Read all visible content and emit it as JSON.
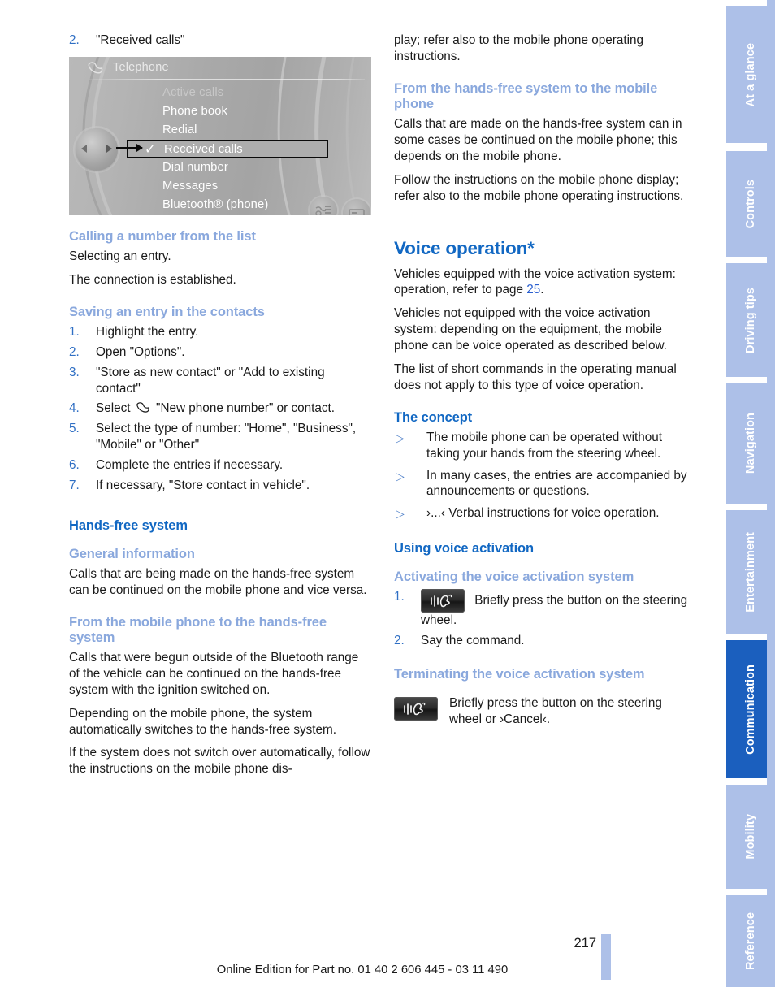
{
  "document": {
    "page_number": "217",
    "footer_text": "Online Edition for Part no. 01 40 2 606 445 - 03 11 490"
  },
  "sidebar": {
    "tabs": [
      {
        "label": "At a glance",
        "active": false
      },
      {
        "label": "Controls",
        "active": false
      },
      {
        "label": "Driving tips",
        "active": false
      },
      {
        "label": "Navigation",
        "active": false
      },
      {
        "label": "Entertainment",
        "active": false
      },
      {
        "label": "Communication",
        "active": true
      },
      {
        "label": "Mobility",
        "active": false
      },
      {
        "label": "Reference",
        "active": false
      }
    ]
  },
  "left_column": {
    "step_intro": {
      "num": "2.",
      "text": "\"Received calls\""
    },
    "idrive": {
      "title": "Telephone",
      "menu_items": [
        {
          "label": "Active calls",
          "dim": true,
          "selected": false
        },
        {
          "label": "Phone book",
          "dim": false,
          "selected": false
        },
        {
          "label": "Redial",
          "dim": false,
          "selected": false
        },
        {
          "label": "Received calls",
          "dim": false,
          "selected": true
        },
        {
          "label": "Dial number",
          "dim": false,
          "selected": false
        },
        {
          "label": "Messages",
          "dim": false,
          "selected": false
        },
        {
          "label": "Bluetooth® (phone)",
          "dim": false,
          "selected": false
        }
      ],
      "checkmark": "✓"
    },
    "calling_heading": "Calling a number from the list",
    "calling_p1": "Selecting an entry.",
    "calling_p2": "The connection is established.",
    "saving_heading": "Saving an entry in the contacts",
    "saving_steps": [
      {
        "num": "1.",
        "text": "Highlight the entry."
      },
      {
        "num": "2.",
        "text": "Open \"Options\"."
      },
      {
        "num": "3.",
        "text": "\"Store as new contact\" or \"Add to existing contact\""
      },
      {
        "num": "4.",
        "text_before": "Select",
        "icon": "phone-handset-icon",
        "text_after": "\"New phone number\" or contact."
      },
      {
        "num": "5.",
        "text": "Select the type of number: \"Home\", \"Business\", \"Mobile\" or \"Other\""
      },
      {
        "num": "6.",
        "text": "Complete the entries if necessary."
      },
      {
        "num": "7.",
        "text": "If necessary, \"Store contact in vehicle\"."
      }
    ],
    "handsfree_heading": "Hands-free system",
    "general_heading": "General information",
    "general_p1": "Calls that are being made on the hands-free system can be continued on the mobile phone and vice versa.",
    "from_mobile_heading": "From the mobile phone to the hands-free system",
    "from_mobile_p1": "Calls that were begun outside of the Bluetooth range of the vehicle can be continued on the hands-free system with the ignition switched on.",
    "from_mobile_p2": "Depending on the mobile phone, the system automatically switches to the hands-free system.",
    "from_mobile_p3": "If the system does not switch over automatically, follow the instructions on the mobile phone dis-"
  },
  "right_column": {
    "continued_p": "play; refer also to the mobile phone operating instructions.",
    "from_handsfree_heading": "From the hands-free system to the mobile phone",
    "from_handsfree_p1": "Calls that are made on the hands-free system can in some cases be continued on the mobile phone; this depends on the mobile phone.",
    "from_handsfree_p2": "Follow the instructions on the mobile phone display; refer also to the mobile phone operating instructions.",
    "voice_heading": "Voice operation*",
    "voice_p1_before": "Vehicles equipped with the voice activation system: operation, refer to page ",
    "voice_p1_link": "25",
    "voice_p1_after": ".",
    "voice_p2": "Vehicles not equipped with the voice activation system: depending on the equipment, the mobile phone can be voice operated as described below.",
    "voice_p3": "The list of short commands in the operating manual does not apply to this type of voice operation.",
    "concept_heading": "The concept",
    "concept_bullets": [
      "The mobile phone can be operated without taking your hands from the steering wheel.",
      "In many cases, the entries are accompanied by announcements or questions.",
      "›...‹ Verbal instructions for voice operation."
    ],
    "using_heading": "Using voice activation",
    "activating_heading": "Activating the voice activation system",
    "activating_steps": [
      {
        "num": "1.",
        "icon": "voice-button-icon",
        "text": "Briefly press the button on the steering wheel."
      },
      {
        "num": "2.",
        "icon": null,
        "text": "Say the command."
      }
    ],
    "terminating_heading": "Terminating the voice activation system",
    "terminating_icon": "voice-button-icon",
    "terminating_text": "Briefly press the button on the steering wheel or ›Cancel‹."
  },
  "colors": {
    "heading_dark_blue": "#1268c3",
    "heading_light_blue": "#8aa8dd",
    "tab_inactive": "#adc0e8",
    "tab_active": "#1b5fbe",
    "link_blue": "#2a5fd0",
    "list_number_blue": "#2f6fc4"
  }
}
